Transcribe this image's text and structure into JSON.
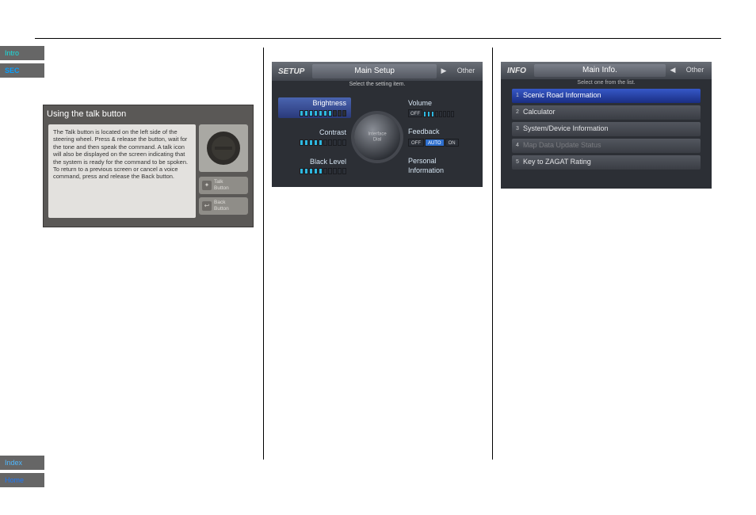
{
  "nav": {
    "intro": "Intro",
    "sec": "SEC",
    "index": "Index",
    "home": "Home"
  },
  "col1": {
    "shot_title": "Using the talk button",
    "shot_body": "The Talk button is located on the left side of the steering wheel. Press & release the button, wait for the tone and then speak the command. A talk icon will also be displayed on the screen indicating that the system is ready for the command to be spoken. To return to a previous screen or cancel a voice command, press and release the Back button.",
    "talk_label": "Talk\nButton",
    "back_label": "Back\nButton"
  },
  "setup": {
    "title_left": "SETUP",
    "title_mid": "Main Setup",
    "title_right": "Other",
    "subtitle": "Select the setting item.",
    "dial_text": "Interface\nDial",
    "left_items": [
      {
        "label": "Brightness",
        "active": true,
        "bars_on": 7,
        "bars_total": 10
      },
      {
        "label": "Contrast",
        "active": false,
        "bars_on": 5,
        "bars_total": 10
      },
      {
        "label": "Black Level",
        "active": false,
        "bars_on": 5,
        "bars_total": 10
      }
    ],
    "right_items": [
      {
        "label": "Volume",
        "type": "vol",
        "off": "OFF",
        "bars_on": 3,
        "bars_total": 8
      },
      {
        "label": "Feedback",
        "type": "feed",
        "opts": [
          "OFF",
          "AUTO",
          "ON"
        ]
      },
      {
        "label": "Personal Information",
        "type": "plain"
      }
    ]
  },
  "info": {
    "title_left": "INFO",
    "title_mid": "Main Info.",
    "title_right": "Other",
    "subtitle": "Select one from the list.",
    "rows": [
      {
        "n": "1",
        "t": "Scenic Road Information",
        "sel": true
      },
      {
        "n": "2",
        "t": "Calculator"
      },
      {
        "n": "3",
        "t": "System/Device Information"
      },
      {
        "n": "4",
        "t": "Map Data Update Status",
        "dis": true
      },
      {
        "n": "5",
        "t": "Key to ZAGAT Rating"
      }
    ]
  }
}
